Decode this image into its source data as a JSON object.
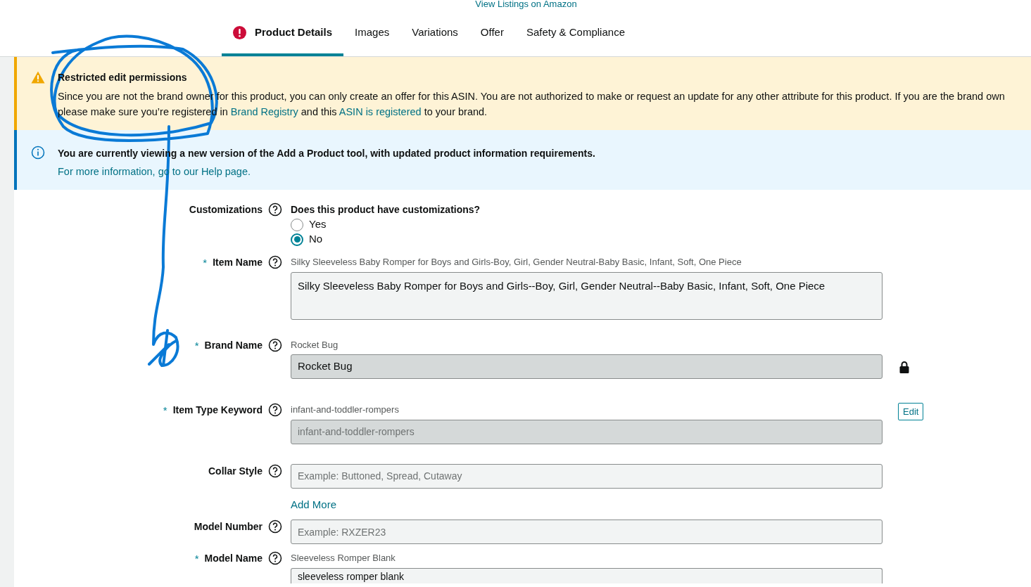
{
  "header_link": "View Listings on Amazon",
  "tabs": [
    {
      "label": "Product Details",
      "selected": true,
      "error": true
    },
    {
      "label": "Images",
      "selected": false,
      "error": false
    },
    {
      "label": "Variations",
      "selected": false,
      "error": false
    },
    {
      "label": "Offer",
      "selected": false,
      "error": false
    },
    {
      "label": "Safety & Compliance",
      "selected": false,
      "error": false
    }
  ],
  "alerts": [
    {
      "kind": "warning",
      "title": "Restricted edit permissions",
      "line_1": "Since you are not the brand owner for this product, you can only create an offer for this ASIN. You are not authorized to make or request an update for any other attribute for this product. If you are the brand own",
      "line_2": [
        {
          "text": "please make sure you’re registered in ",
          "link": false
        },
        {
          "text": "Brand Registry",
          "link": true
        },
        {
          "text": " and this ",
          "link": false
        },
        {
          "text": "ASIN is registered",
          "link": true
        },
        {
          "text": " to your brand.",
          "link": false
        }
      ]
    },
    {
      "kind": "info",
      "title": "You are currently viewing a new version of the Add a Product tool, with updated product information requirements.",
      "line_1": "For more information, go to our Help page."
    }
  ],
  "fields": [
    {
      "kind": "radio",
      "label": "Customizations",
      "question": "Does this product have customizations?",
      "options": [
        {
          "label": "Yes",
          "selected": false
        },
        {
          "label": "No",
          "selected": true
        }
      ]
    },
    {
      "kind": "textarea",
      "label": "Item Name",
      "required_mark": "*",
      "hint": "Silky Sleeveless Baby Romper for Boys and Girls-Boy, Girl, Gender Neutral-Baby Basic, Infant, Soft, One Piece",
      "value": "Silky Sleeveless Baby Romper for Boys and Girls--Boy, Girl, Gender Neutral--Baby Basic, Infant, Soft, One Piece"
    },
    {
      "kind": "locked",
      "label": "Brand Name",
      "required_mark": "*",
      "hint": "Rocket Bug",
      "value": "Rocket Bug"
    },
    {
      "kind": "keyword",
      "label": "Item Type Keyword",
      "required_mark": "*",
      "hint": "infant-and-toddler-rompers",
      "value": "infant-and-toddler-rompers",
      "button": "Edit"
    },
    {
      "kind": "input",
      "label": "Collar Style",
      "placeholder": "Example: Buttoned, Spread, Cutaway",
      "add_more": "Add More"
    },
    {
      "kind": "input",
      "label": "Model Number",
      "placeholder": "Example: RXZER23"
    },
    {
      "kind": "input",
      "label": "Model Name",
      "required_mark": "*",
      "hint": "Sleeveless Romper Blank",
      "value": "sleeveless romper blank"
    }
  ]
}
